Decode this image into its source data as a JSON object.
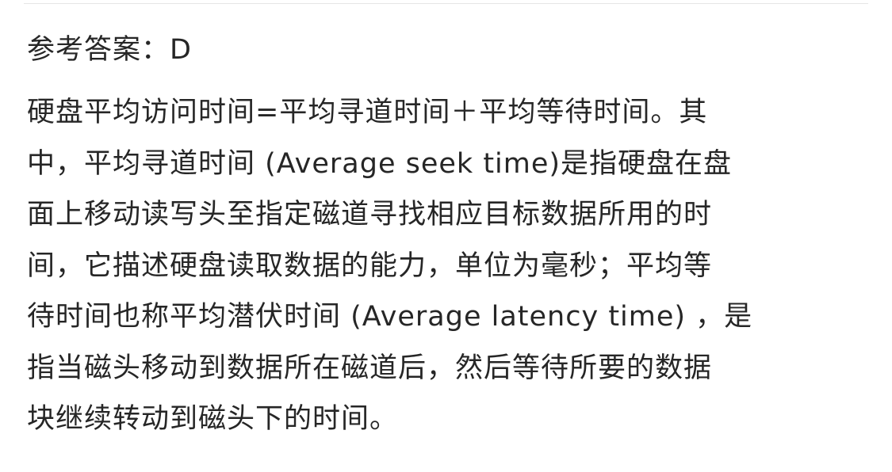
{
  "answer": {
    "label": "参考答案：",
    "value": "D"
  },
  "explanation": {
    "lines": [
      "硬盘平均访问时间=平均寻道时间＋平均等待时间。其",
      "中，平均寻道时间 (Average seek time)是指硬盘在盘",
      "面上移动读写头至指定磁道寻找相应目标数据所用的时",
      "间，它描述硬盘读取数据的能力，单位为毫秒；平均等",
      "待时间也称平均潜伏时间 (Average latency time) ，是",
      "指当磁头移动到数据所在磁道后，然后等待所要的数据",
      "块继续转动到磁头下的时间。"
    ]
  }
}
